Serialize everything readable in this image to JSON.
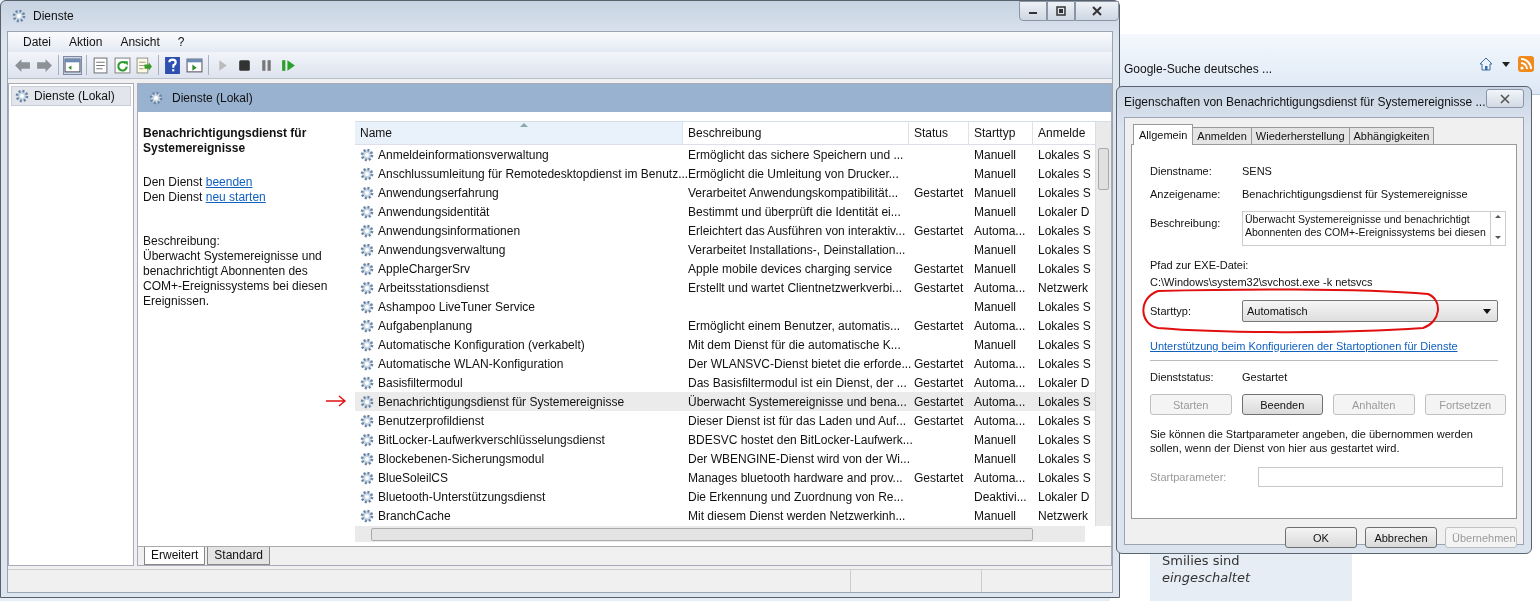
{
  "browser": {
    "search_text": "Google-Suche deutsches ...",
    "sidebar_lines": [
      "Smilies sind",
      "eingeschaltet"
    ]
  },
  "window": {
    "title": "Dienste"
  },
  "menu": [
    "Datei",
    "Aktion",
    "Ansicht",
    "?"
  ],
  "toolbar": [
    {
      "kind": "back"
    },
    {
      "kind": "forward"
    },
    {
      "kind": "sep"
    },
    {
      "kind": "tree"
    },
    {
      "kind": "sep"
    },
    {
      "kind": "properties"
    },
    {
      "kind": "refresh"
    },
    {
      "kind": "export"
    },
    {
      "kind": "sep"
    },
    {
      "kind": "help"
    },
    {
      "kind": "view"
    },
    {
      "kind": "sep"
    },
    {
      "kind": "play"
    },
    {
      "kind": "stop"
    },
    {
      "kind": "pause"
    },
    {
      "kind": "resume"
    }
  ],
  "tree": [
    {
      "label": "Dienste (Lokal)",
      "selected": true
    }
  ],
  "pane_header": "Dienste (Lokal)",
  "details": {
    "title": "Benachrichtigungsdienst für Systemereignisse",
    "actions": [
      {
        "prefix": "Den Dienst",
        "link": "beenden"
      },
      {
        "prefix": "Den Dienst",
        "link": "neu starten"
      }
    ],
    "description_label": "Beschreibung:",
    "description": "Überwacht Systemereignisse und benachrichtigt Abonnenten des COM+-Ereignissystems bei diesen Ereignissen."
  },
  "table": {
    "columns": [
      "Name",
      "Beschreibung",
      "Status",
      "Starttyp",
      "Anmelde"
    ],
    "rows": [
      {
        "name": "Anmeldeinformationsverwaltung",
        "description": "Ermöglicht das sichere Speichern und ...",
        "status": "",
        "startup": "Manuell",
        "logon": "Lokales S",
        "selected": false
      },
      {
        "name": "Anschlussumleitung für Remotedesktopdienst im Benutz...",
        "description": "Ermöglicht die Umleitung von Drucker...",
        "status": "",
        "startup": "Manuell",
        "logon": "Lokales S",
        "selected": false
      },
      {
        "name": "Anwendungserfahrung",
        "description": "Verarbeitet Anwendungskompatibilität...",
        "status": "Gestartet",
        "startup": "Manuell",
        "logon": "Lokales S",
        "selected": false
      },
      {
        "name": "Anwendungsidentität",
        "description": "Bestimmt und überprüft die Identität ei...",
        "status": "",
        "startup": "Manuell",
        "logon": "Lokaler D",
        "selected": false
      },
      {
        "name": "Anwendungsinformationen",
        "description": "Erleichtert das Ausführen von interaktiv...",
        "status": "Gestartet",
        "startup": "Automa...",
        "logon": "Lokales S",
        "selected": false
      },
      {
        "name": "Anwendungsverwaltung",
        "description": "Verarbeitet Installations-, Deinstallation...",
        "status": "",
        "startup": "Manuell",
        "logon": "Lokales S",
        "selected": false
      },
      {
        "name": "AppleChargerSrv",
        "description": "Apple mobile devices charging service",
        "status": "Gestartet",
        "startup": "Manuell",
        "logon": "Lokales S",
        "selected": false
      },
      {
        "name": "Arbeitsstationsdienst",
        "description": "Erstellt und wartet Clientnetzwerkverbi...",
        "status": "Gestartet",
        "startup": "Automa...",
        "logon": "Netzwerk",
        "selected": false
      },
      {
        "name": "Ashampoo LiveTuner Service",
        "description": "",
        "status": "",
        "startup": "Manuell",
        "logon": "Lokales S",
        "selected": false
      },
      {
        "name": "Aufgabenplanung",
        "description": "Ermöglicht einem Benutzer, automatis...",
        "status": "Gestartet",
        "startup": "Automa...",
        "logon": "Lokales S",
        "selected": false
      },
      {
        "name": "Automatische Konfiguration (verkabelt)",
        "description": "Mit dem Dienst für die automatische K...",
        "status": "",
        "startup": "Manuell",
        "logon": "Lokales S",
        "selected": false
      },
      {
        "name": "Automatische WLAN-Konfiguration",
        "description": "Der WLANSVC-Dienst bietet die erforde...",
        "status": "Gestartet",
        "startup": "Automa...",
        "logon": "Lokales S",
        "selected": false
      },
      {
        "name": "Basisfiltermodul",
        "description": "Das Basisfiltermodul ist ein Dienst, der ...",
        "status": "Gestartet",
        "startup": "Automa...",
        "logon": "Lokaler D",
        "selected": false
      },
      {
        "name": "Benachrichtigungsdienst für Systemereignisse",
        "description": "Überwacht Systemereignisse und bena...",
        "status": "Gestartet",
        "startup": "Automa...",
        "logon": "Lokales S",
        "selected": true,
        "marked": true
      },
      {
        "name": "Benutzerprofildienst",
        "description": "Dieser Dienst ist für das Laden und Auf...",
        "status": "Gestartet",
        "startup": "Automa...",
        "logon": "Lokales S",
        "selected": false
      },
      {
        "name": "BitLocker-Laufwerkverschlüsselungsdienst",
        "description": "BDESVC hostet den BitLocker-Laufwerk...",
        "status": "",
        "startup": "Manuell",
        "logon": "Lokales S",
        "selected": false
      },
      {
        "name": "Blockebenen-Sicherungsmodul",
        "description": "Der WBENGINE-Dienst wird von der Wi...",
        "status": "",
        "startup": "Manuell",
        "logon": "Lokales S",
        "selected": false
      },
      {
        "name": "BlueSoleilCS",
        "description": "Manages bluetooth hardware and prov...",
        "status": "Gestartet",
        "startup": "Automa...",
        "logon": "Lokales S",
        "selected": false
      },
      {
        "name": "Bluetooth-Unterstützungsdienst",
        "description": "Die Erkennung und Zuordnung von Re...",
        "status": "",
        "startup": "Deaktivi...",
        "logon": "Lokaler D",
        "selected": false
      },
      {
        "name": "BranchCache",
        "description": "Mit diesem Dienst werden Netzwerkinh...",
        "status": "",
        "startup": "Manuell",
        "logon": "Netzwerk",
        "selected": false
      }
    ]
  },
  "bottom_tabs": [
    {
      "label": "Erweitert",
      "selected": true
    },
    {
      "label": "Standard",
      "selected": false
    }
  ],
  "dialog": {
    "title": "Eigenschaften von Benachrichtigungsdienst für Systemereignisse ...",
    "tabs": [
      {
        "label": "Allgemein",
        "selected": true
      },
      {
        "label": "Anmelden",
        "selected": false
      },
      {
        "label": "Wiederherstellung",
        "selected": false
      },
      {
        "label": "Abhängigkeiten",
        "selected": false
      }
    ],
    "service_name": {
      "label": "Dienstname:",
      "value": "SENS"
    },
    "display_name": {
      "label": "Anzeigename:",
      "value": "Benachrichtigungsdienst für Systemereignisse"
    },
    "description": {
      "label": "Beschreibung:",
      "lines": [
        "Überwacht Systemereignisse und benachrichtigt",
        "Abonnenten des COM+-Ereignissystems bei diesen"
      ]
    },
    "path_label": "Pfad zur EXE-Datei:",
    "path": "C:\\Windows\\system32\\svchost.exe -k netsvcs",
    "startup": {
      "label": "Starttyp:",
      "value": "Automatisch",
      "circled": true
    },
    "help_link": "Unterstützung beim Konfigurieren der Startoptionen für Dienste",
    "status": {
      "label": "Dienststatus:",
      "value": "Gestartet"
    },
    "service_buttons": [
      {
        "label": "Starten",
        "disabled": true
      },
      {
        "label": "Beenden",
        "disabled": false
      },
      {
        "label": "Anhalten",
        "disabled": true
      },
      {
        "label": "Fortsetzen",
        "disabled": true
      }
    ],
    "hint": "Sie können die Startparameter angeben, die übernommen werden sollen, wenn der Dienst von hier aus gestartet wird.",
    "parameter": {
      "label": "Startparameter:",
      "disabled": true
    },
    "buttons": [
      {
        "label": "OK",
        "disabled": false
      },
      {
        "label": "Abbrechen",
        "disabled": false
      },
      {
        "label": "Übernehmen",
        "disabled": true
      }
    ]
  }
}
